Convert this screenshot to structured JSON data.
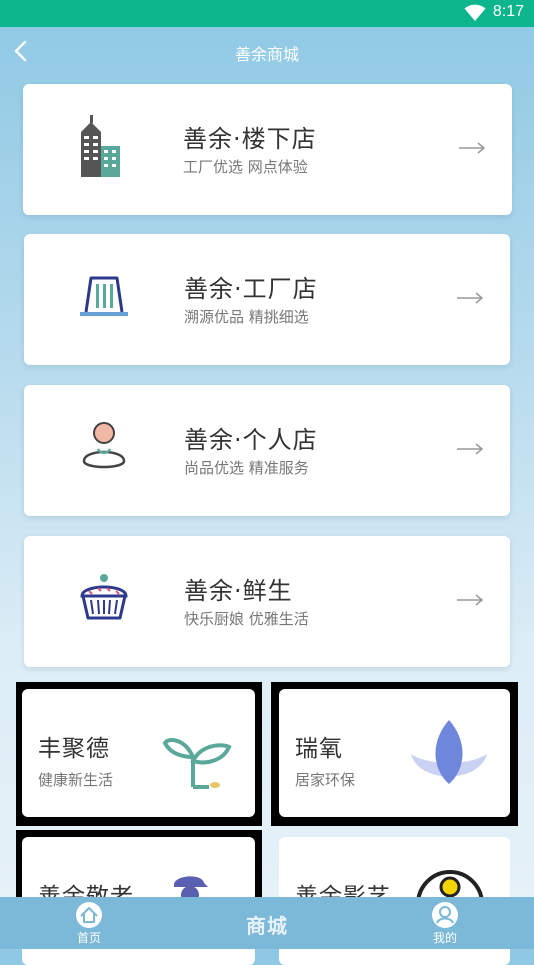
{
  "status_bar": {
    "time": "8:17"
  },
  "header": {
    "title": "善余商城"
  },
  "stores": [
    {
      "title": "善余·楼下店",
      "subtitle": "工厂优选  网点体验",
      "icon": "building-icon"
    },
    {
      "title": "善余·工厂店",
      "subtitle": "溯源优品  精挑细选",
      "icon": "factory-icon"
    },
    {
      "title": "善余·个人店",
      "subtitle": "尚品优选  精准服务",
      "icon": "person-icon"
    },
    {
      "title": "善余·鲜生",
      "subtitle": "快乐厨娘  优雅生活",
      "icon": "cupcake-icon"
    }
  ],
  "tiles": [
    {
      "title": "丰聚德",
      "subtitle": "健康新生活",
      "icon": "sprout-icon"
    },
    {
      "title": "瑞氧",
      "subtitle": "居家环保",
      "icon": "lotus-icon"
    },
    {
      "title": "善余敬老",
      "subtitle": "",
      "icon": "elder-icon"
    },
    {
      "title": "善余影艺",
      "subtitle": "",
      "icon": "film-reel-icon"
    }
  ],
  "bottom_nav": {
    "home_label": "首页",
    "center_label": "商城",
    "mine_label": "我的"
  },
  "colors": {
    "status_bar": "#0cb58b",
    "nav_bar": "#7cb8d7",
    "accent_green": "#5aa89a",
    "icon_navy": "#2d3a8c"
  }
}
